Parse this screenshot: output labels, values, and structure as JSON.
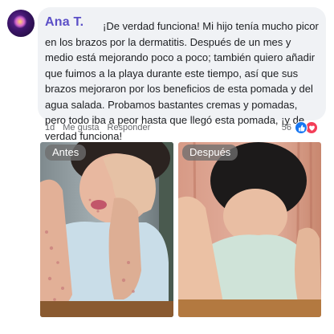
{
  "comment": {
    "author": "Ana T.",
    "text": "¡De verdad funciona! Mi hijo tenía mucho picor en los brazos por la dermatitis. Después de un mes y medio está mejorando poco a poco; también quiero añadir que fuimos a la playa durante este tiempo, así que sus brazos mejoraron por los beneficios de esta pomada y del agua salada. Probamos bastantes cremas y pomadas, pero todo iba a peor hasta que llegó esta pomada, ¡y de verdad funciona!"
  },
  "actions": {
    "time": "1d",
    "like": "Me gusta",
    "reply": "Responder"
  },
  "reactions": {
    "count": "56",
    "icons": [
      "like-icon",
      "love-icon"
    ]
  },
  "photos": {
    "before_label": "Antes",
    "after_label": "Después"
  },
  "colors": {
    "author": "#5b4fc7",
    "bubble": "#f0f2f5",
    "like": "#1877f2",
    "love": "#f33e58"
  }
}
